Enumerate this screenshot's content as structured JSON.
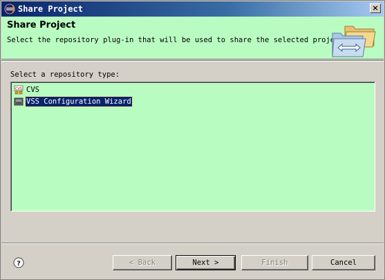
{
  "window": {
    "title": "Share Project",
    "app_icon": "eclipse-icon",
    "close_label": "×"
  },
  "banner": {
    "title": "Share Project",
    "description": "Select the repository plug-in that will be used to share the selected project.",
    "graphic": "share-folders-icon"
  },
  "repository": {
    "label": "Select a repository type:",
    "items": [
      {
        "label": "CVS",
        "icon": "cvs-icon",
        "selected": false
      },
      {
        "label": "VSS Configuration Wizard",
        "icon": "vss-icon",
        "selected": true
      }
    ]
  },
  "buttons": {
    "back": "< Back",
    "next": "Next >",
    "finish": "Finish",
    "cancel": "Cancel",
    "back_enabled": false,
    "finish_enabled": false
  },
  "help": {
    "icon": "help-icon"
  },
  "colors": {
    "banner_bg": "#b9fcc1",
    "list_bg": "#b9fcc1",
    "selection_bg": "#0a246a",
    "titlebar_start": "#0a246a"
  }
}
